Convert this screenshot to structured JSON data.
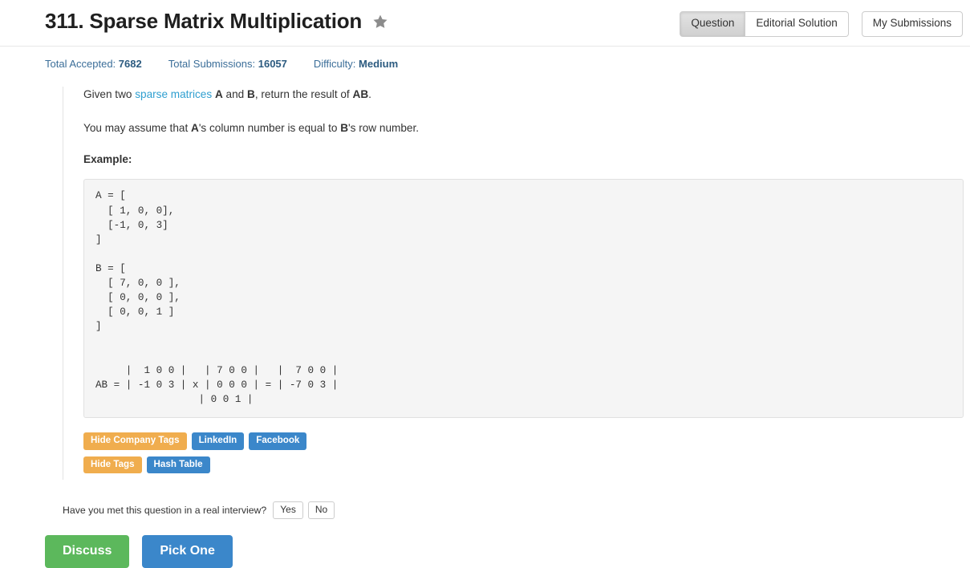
{
  "header": {
    "title": "311. Sparse Matrix Multiplication",
    "star_icon": "star-icon",
    "tabs": [
      {
        "label": "Question",
        "active": true
      },
      {
        "label": "Editorial Solution",
        "active": false
      }
    ],
    "my_submissions_label": "My Submissions"
  },
  "stats": [
    {
      "label": "Total Accepted:",
      "value": "7682"
    },
    {
      "label": "Total Submissions:",
      "value": "16057"
    },
    {
      "label": "Difficulty:",
      "value": "Medium"
    }
  ],
  "description": {
    "line1_pre": "Given two ",
    "line1_link": "sparse matrices",
    "line1_mid1": " ",
    "line1_bold_a": "A",
    "line1_mid2": " and ",
    "line1_bold_b": "B",
    "line1_mid3": ", return the result of ",
    "line1_bold_ab": "AB",
    "line1_end": ".",
    "line2_pre": "You may assume that ",
    "line2_bold_a": "A",
    "line2_mid": "'s column number is equal to ",
    "line2_bold_b": "B",
    "line2_end": "'s row number.",
    "example_label": "Example:"
  },
  "code": {
    "matrix_a_label": "A",
    "matrix_b_label": "B",
    "result_label": "AB",
    "text": "A = [\n  [ 1, 0, 0],\n  [-1, 0, 3]\n]\n\nB = [\n  [ 7, 0, 0 ],\n  [ 0, 0, 0 ],\n  [ 0, 0, 1 ]\n]\n\n\n     |  1 0 0 |   | 7 0 0 |   |  7 0 0 |\nAB = | -1 0 3 | x | 0 0 0 | = | -7 0 3 |\n                 | 0 0 1 |\n"
  },
  "tags": {
    "company_row": [
      {
        "label": "Hide Company Tags",
        "style": "orange"
      },
      {
        "label": "LinkedIn",
        "style": "blue"
      },
      {
        "label": "Facebook",
        "style": "blue"
      }
    ],
    "topic_row": [
      {
        "label": "Hide Tags",
        "style": "orange"
      },
      {
        "label": "Hash Table",
        "style": "blue"
      }
    ]
  },
  "interview": {
    "question": "Have you met this question in a real interview?",
    "yes_label": "Yes",
    "no_label": "No"
  },
  "footer": {
    "discuss_label": "Discuss",
    "pick_one_label": "Pick One"
  },
  "colors": {
    "orange": "#f0ad4e",
    "blue": "#3b87ca",
    "green": "#5cb85c",
    "link": "#2f9fd0",
    "stat_text": "#3b6e99",
    "code_bg": "#f5f5f5"
  }
}
